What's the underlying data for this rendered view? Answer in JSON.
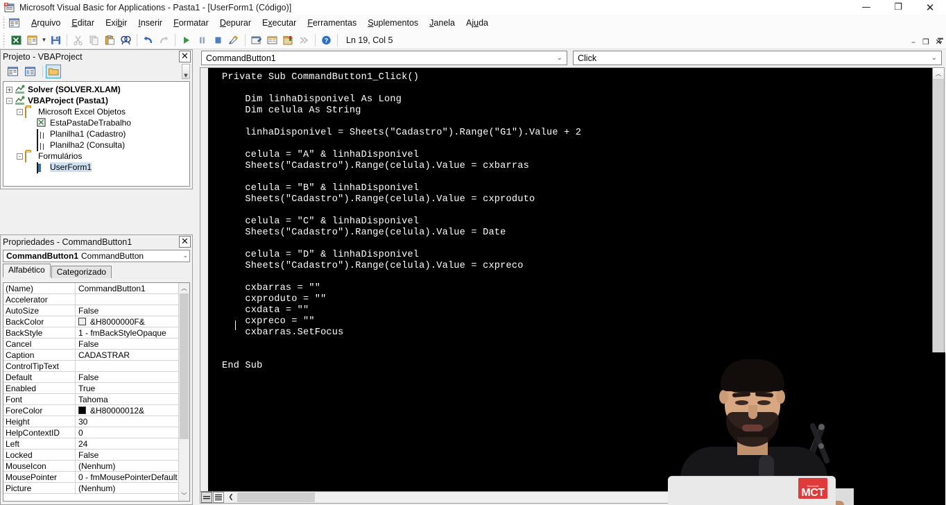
{
  "window": {
    "title": "Microsoft Visual Basic for Applications - Pasta1 - [UserForm1 (Código)]",
    "app_icon": "vba-icon",
    "minimize": "—",
    "restore": "❐",
    "close": "✕"
  },
  "mdi": {
    "minimize": "–",
    "restore": "❐",
    "close": "✕"
  },
  "menubar": {
    "icon": "project-icon",
    "items": [
      {
        "label": "Arquivo",
        "accel": "A"
      },
      {
        "label": "Editar",
        "accel": "E"
      },
      {
        "label": "Exibir",
        "accel": "b"
      },
      {
        "label": "Inserir",
        "accel": "I"
      },
      {
        "label": "Formatar",
        "accel": "F"
      },
      {
        "label": "Depurar",
        "accel": "D"
      },
      {
        "label": "Executar",
        "accel": "x"
      },
      {
        "label": "Ferramentas",
        "accel": "F"
      },
      {
        "label": "Suplementos",
        "accel": "S"
      },
      {
        "label": "Janela",
        "accel": "J"
      },
      {
        "label": "Ajuda",
        "accel": "u"
      }
    ]
  },
  "toolbar": {
    "buttons": [
      "view-excel-icon",
      "insert-userform-icon",
      "save-icon",
      "cut-icon",
      "copy-icon",
      "paste-icon",
      "find-icon",
      "undo-icon",
      "redo-icon",
      "run-icon",
      "break-icon",
      "reset-icon",
      "design-mode-icon",
      "project-explorer-icon",
      "properties-window-icon",
      "object-browser-icon",
      "toolbox-icon",
      "help-icon"
    ],
    "status": "Ln 19, Col 5"
  },
  "project_explorer": {
    "title": "Projeto - VBAProject",
    "close": "✕",
    "toolbar": [
      "view-code-icon",
      "view-object-icon",
      "toggle-folders-icon"
    ],
    "tree": [
      {
        "label": "Solver (SOLVER.XLAM)",
        "icon": "project-node-icon",
        "indent": 0,
        "expander": "+",
        "bold": true
      },
      {
        "label": "VBAProject (Pasta1)",
        "icon": "project-node-icon",
        "indent": 0,
        "expander": "-",
        "bold": true
      },
      {
        "label": "Microsoft Excel Objetos",
        "icon": "folder-icon",
        "indent": 1,
        "expander": "-",
        "bold": false
      },
      {
        "label": "EstaPastaDeTrabalho",
        "icon": "workbook-icon",
        "indent": 2,
        "expander": "",
        "bold": false
      },
      {
        "label": "Planilha1 (Cadastro)",
        "icon": "worksheet-icon",
        "indent": 2,
        "expander": "",
        "bold": false
      },
      {
        "label": "Planilha2 (Consulta)",
        "icon": "worksheet-icon",
        "indent": 2,
        "expander": "",
        "bold": false
      },
      {
        "label": "Formulários",
        "icon": "folder-icon",
        "indent": 1,
        "expander": "-",
        "bold": false
      },
      {
        "label": "UserForm1",
        "icon": "userform-icon",
        "indent": 2,
        "expander": "",
        "bold": false,
        "selected": true
      }
    ]
  },
  "properties": {
    "title": "Propriedades - CommandButton1",
    "close": "✕",
    "object_name": "CommandButton1",
    "object_type": "CommandButton",
    "tabs": [
      {
        "label": "Alfabético",
        "active": true
      },
      {
        "label": "Categorizado",
        "active": false
      }
    ],
    "rows": [
      {
        "name": "(Name)",
        "value": "CommandButton1"
      },
      {
        "name": "Accelerator",
        "value": ""
      },
      {
        "name": "AutoSize",
        "value": "False"
      },
      {
        "name": "BackColor",
        "value": "&H8000000F&",
        "swatch": "#f0f0f0"
      },
      {
        "name": "BackStyle",
        "value": "1 - fmBackStyleOpaque"
      },
      {
        "name": "Cancel",
        "value": "False"
      },
      {
        "name": "Caption",
        "value": "CADASTRAR"
      },
      {
        "name": "ControlTipText",
        "value": ""
      },
      {
        "name": "Default",
        "value": "False"
      },
      {
        "name": "Enabled",
        "value": "True"
      },
      {
        "name": "Font",
        "value": "Tahoma"
      },
      {
        "name": "ForeColor",
        "value": "&H80000012&",
        "swatch": "#000000"
      },
      {
        "name": "Height",
        "value": "30"
      },
      {
        "name": "HelpContextID",
        "value": "0"
      },
      {
        "name": "Left",
        "value": "24"
      },
      {
        "name": "Locked",
        "value": "False"
      },
      {
        "name": "MouseIcon",
        "value": "(Nenhum)"
      },
      {
        "name": "MousePointer",
        "value": "0 - fmMousePointerDefault"
      },
      {
        "name": "Picture",
        "value": "(Nenhum)"
      }
    ]
  },
  "code_window": {
    "object_combo": "CommandButton1",
    "procedure_combo": "Click",
    "code": "Private Sub CommandButton1_Click()\n\n    Dim linhaDisponivel As Long\n    Dim celula As String\n\n    linhaDisponivel = Sheets(\"Cadastro\").Range(\"G1\").Value + 2\n\n    celula = \"A\" & linhaDisponivel\n    Sheets(\"Cadastro\").Range(celula).Value = cxbarras\n\n    celula = \"B\" & linhaDisponivel\n    Sheets(\"Cadastro\").Range(celula).Value = cxproduto\n\n    celula = \"C\" & linhaDisponivel\n    Sheets(\"Cadastro\").Range(celula).Value = Date\n\n    celula = \"D\" & linhaDisponivel\n    Sheets(\"Cadastro\").Range(celula).Value = cxpreco\n\n    cxbarras = \"\"\n    cxproduto = \"\"\n    cxdata = \"\"\n    cxpreco = \"\"\n    cxbarras.SetFocus\n\n\nEnd Sub",
    "view_buttons": [
      "procedure-view-icon",
      "full-module-view-icon"
    ],
    "background": "#000000",
    "foreground": "#ffffff"
  },
  "webcam": {
    "laptop_sticker": "MCT",
    "laptop_sticker_top": "Microsoft"
  }
}
